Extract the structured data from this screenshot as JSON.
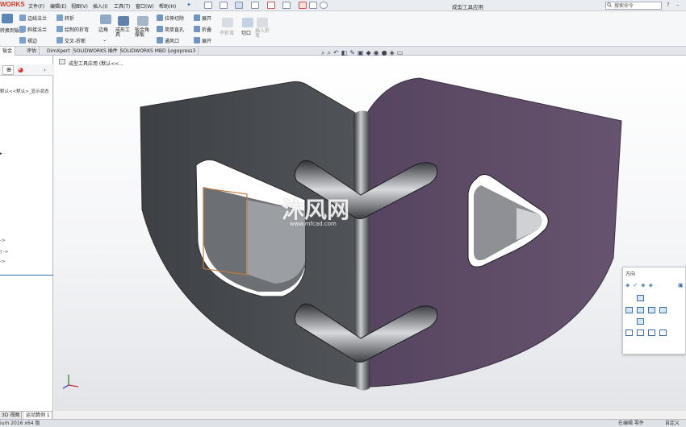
{
  "app": {
    "brand": "WORKS",
    "doc_title": "成型工具应用",
    "search_placeholder": "搜索命令"
  },
  "menu": [
    "文件(F)",
    "编辑(E)",
    "视图(V)",
    "插入(I)",
    "工具(T)",
    "窗口(W)",
    "帮助(H)"
  ],
  "ribbon": {
    "col1": [
      "转换到钣金",
      "边线法兰",
      "斜接法兰",
      "褶边"
    ],
    "col2": [
      "转折",
      "绘制的折弯",
      "交叉-折断"
    ],
    "col3": [
      "边角"
    ],
    "col4": [
      "成形工具",
      "钣金角撑板"
    ],
    "col5": [
      "拉伸切除",
      "简单直孔",
      "通风口"
    ],
    "col6": [
      "展开",
      "折叠",
      "展开"
    ],
    "col7": [
      "不折弯",
      "插入折弯"
    ],
    "col8": [
      "切口"
    ]
  },
  "tabs": [
    "钣金",
    "评估",
    "DimXpert",
    "SOLIDWORKS 插件",
    "SOLIDWORKS MBD",
    "Logopress3"
  ],
  "active_tab": 0,
  "viewport": {
    "tree_label": "成型工具应用 (默认<<..."
  },
  "left_panel": {
    "config_line": "默认<<默认>_显示状态"
  },
  "orientation": {
    "title": "方向"
  },
  "bottom_tabs": [
    "3D 视图",
    "运动算例 1"
  ],
  "status": {
    "version": "ium 2016 x64 版",
    "editing": "在编辑 零件",
    "custom": "自定义"
  },
  "watermark": {
    "name": "沐风网",
    "url": "www.mfcad.com"
  },
  "colors": {
    "left_face": "#474a4e",
    "right_face": "#5e4b67",
    "selection": "#c07a3a",
    "brand": "#d43a2a"
  }
}
